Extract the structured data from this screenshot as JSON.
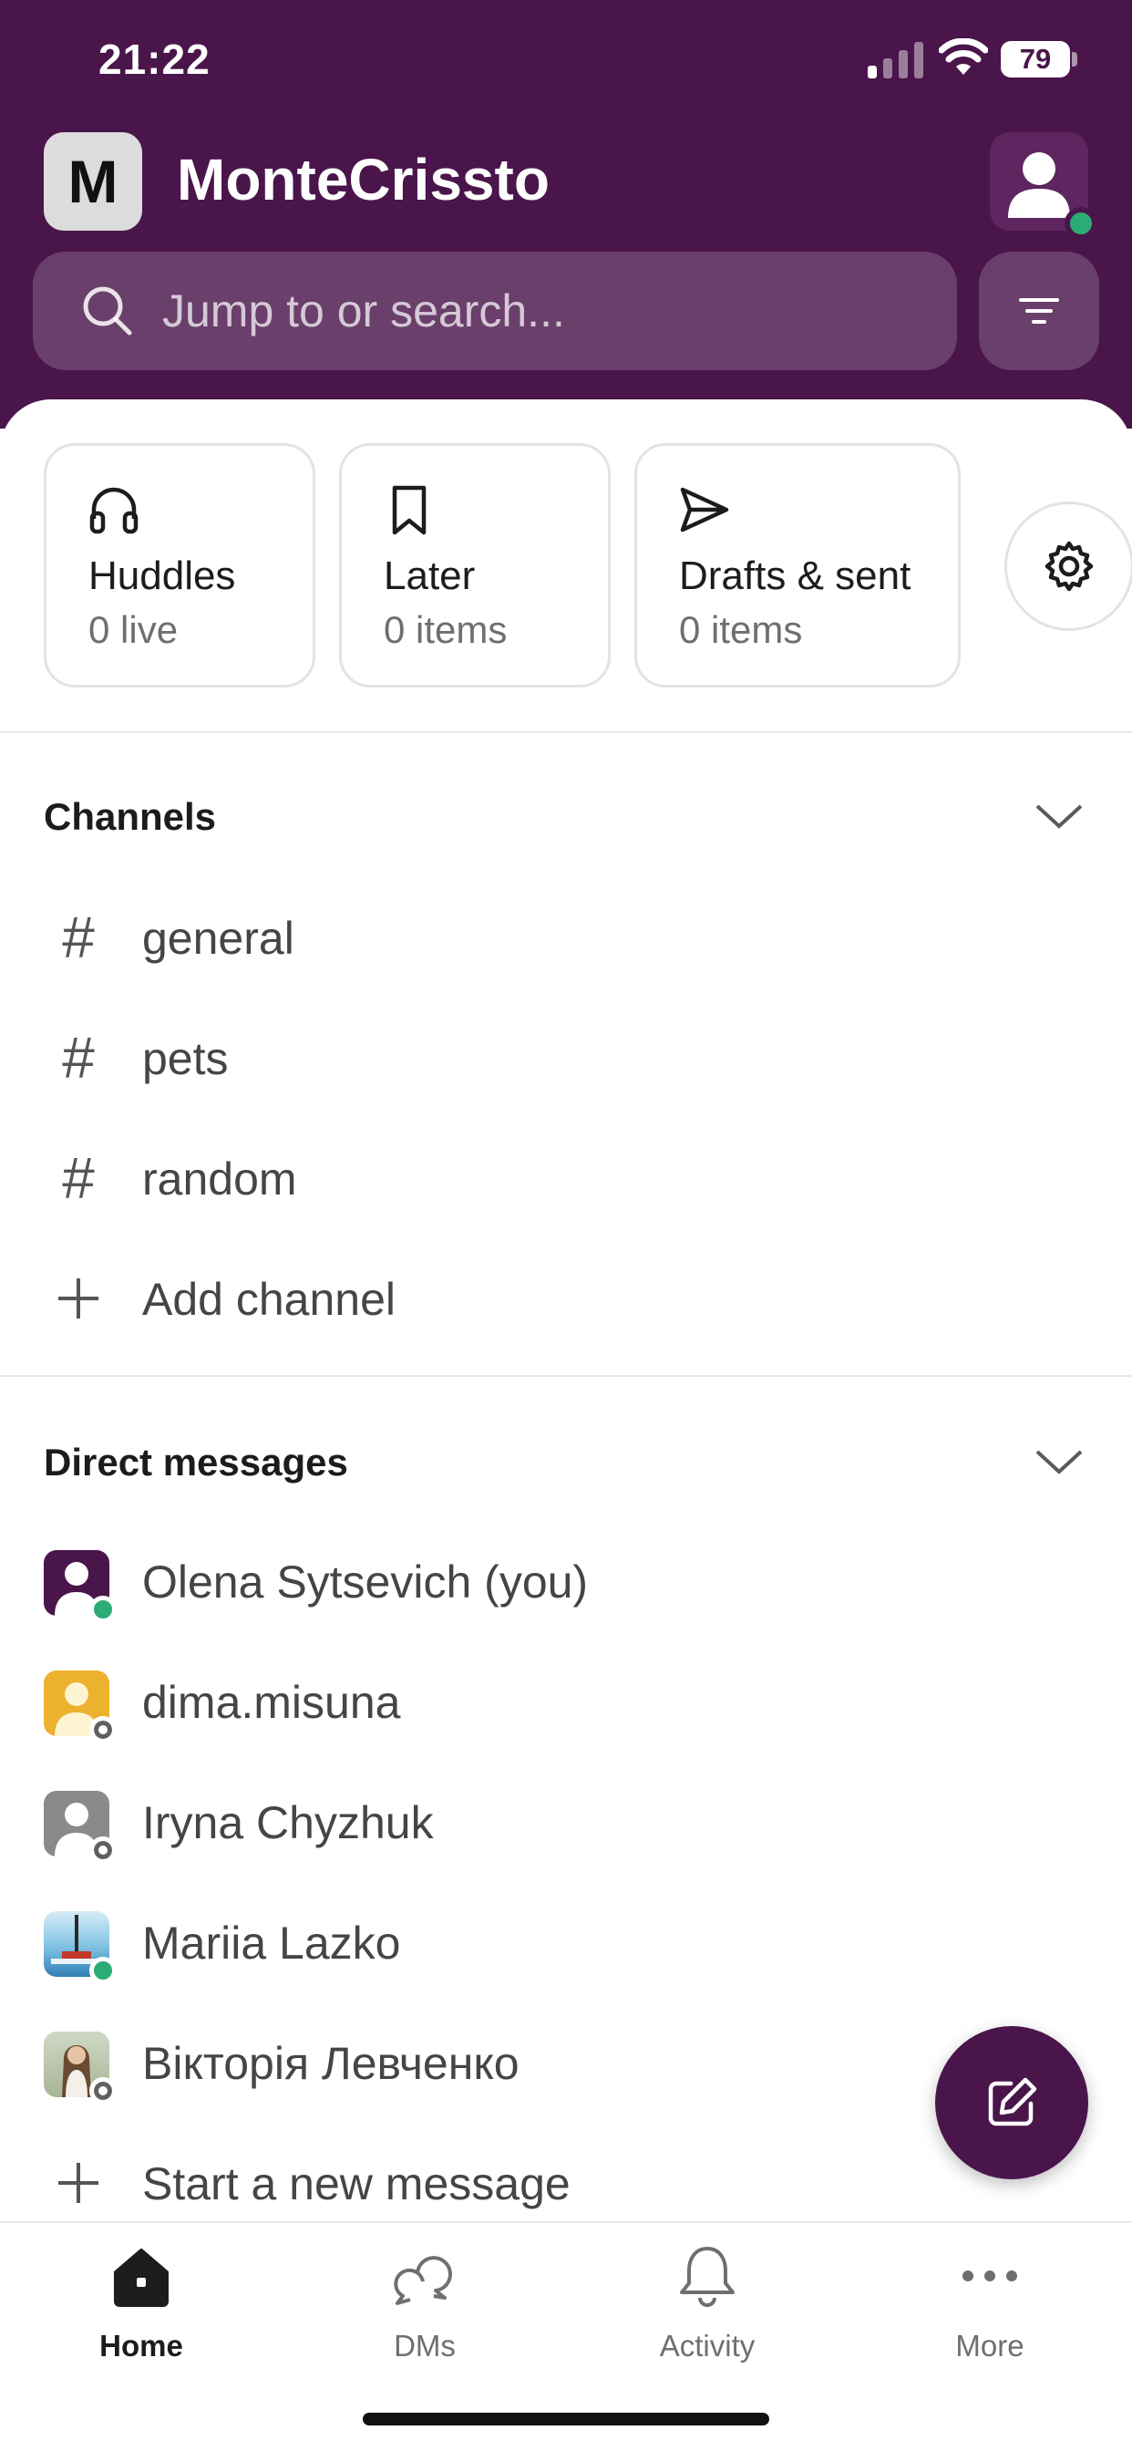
{
  "status_bar": {
    "time": "21:22",
    "battery": "79"
  },
  "workspace": {
    "initial": "M",
    "name": "MonteCrissto"
  },
  "search": {
    "placeholder": "Jump to or search..."
  },
  "quick_cards": [
    {
      "icon": "headphones-icon",
      "title": "Huddles",
      "subtitle": "0 live"
    },
    {
      "icon": "bookmark-icon",
      "title": "Later",
      "subtitle": "0 items"
    },
    {
      "icon": "send-icon",
      "title": "Drafts & sent",
      "subtitle": "0 items"
    }
  ],
  "channels": {
    "title": "Channels",
    "items": [
      "general",
      "pets",
      "random"
    ],
    "add_label": "Add channel"
  },
  "direct_messages": {
    "title": "Direct messages",
    "items": [
      {
        "name": "Olena Sytsevich (you)",
        "status": "online",
        "color": "#4a154b"
      },
      {
        "name": "dima.misuna",
        "status": "away",
        "color": "#ecb22e"
      },
      {
        "name": "Iryna Chyzhuk",
        "status": "away",
        "color": "#8a8a8a"
      },
      {
        "name": "Mariia Lazko",
        "status": "online",
        "color": "#5aa9d6"
      },
      {
        "name": "Вікторія Левченко",
        "status": "away",
        "color": "#9c7b5e"
      }
    ],
    "new_message_label": "Start a new message"
  },
  "tabs": [
    {
      "label": "Home",
      "icon": "home-icon",
      "active": true
    },
    {
      "label": "DMs",
      "icon": "dms-icon",
      "active": false
    },
    {
      "label": "Activity",
      "icon": "bell-icon",
      "active": false
    },
    {
      "label": "More",
      "icon": "more-icon",
      "active": false
    }
  ],
  "colors": {
    "brand": "#4a154b",
    "online": "#2bac76"
  }
}
